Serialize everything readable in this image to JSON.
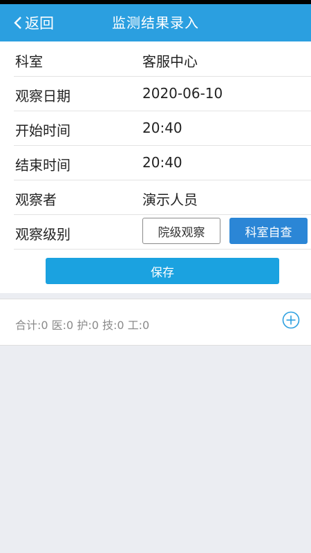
{
  "nav": {
    "back_label": "返回",
    "title": "监测结果录入"
  },
  "form": {
    "rows": [
      {
        "label": "科室",
        "value": "客服中心"
      },
      {
        "label": "观察日期",
        "value": "2020-06-10"
      },
      {
        "label": "开始时间",
        "value": "20:40"
      },
      {
        "label": "结束时间",
        "value": "20:40"
      },
      {
        "label": "观察者",
        "value": "演示人员"
      },
      {
        "label": "观察级别"
      }
    ],
    "level_options": [
      {
        "label": "院级观察",
        "selected": false
      },
      {
        "label": "科室自查",
        "selected": true
      }
    ],
    "save_label": "保存"
  },
  "summary": {
    "text": "合计:0 医:0 护:0 技:0 工:0"
  },
  "icons": {
    "back": "chevron-left-icon",
    "add": "add-circle-icon"
  },
  "colors": {
    "nav_bg": "#2b9fe0",
    "primary_button": "#1ba2e0",
    "selected_option": "#2b86d6",
    "page_bg": "#ebedf2"
  }
}
